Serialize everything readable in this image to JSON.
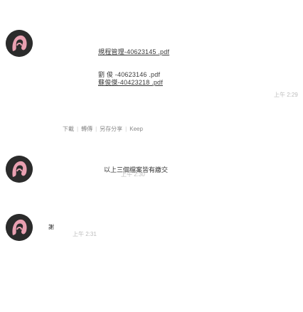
{
  "messages": [
    {
      "lines": [
        "規程管理-40623145 .pdf",
        "劉 俊 -40623146 .pdf",
        "蘇俊傑-40423218 .pdf"
      ],
      "time": "上午 2:29",
      "actions": [
        "下載",
        "轉傳",
        "另存分享",
        "Keep"
      ]
    },
    {
      "text": "以上三個檔案皆有繳交",
      "time": "上午 2:30"
    },
    {
      "text": "謝",
      "time": "上午 2:31"
    }
  ],
  "icons": {
    "avatar": "person-avatar-icon"
  },
  "colors": {
    "avatar_bg": "#2b2b2b",
    "avatar_fg": "#e9a0b1"
  }
}
